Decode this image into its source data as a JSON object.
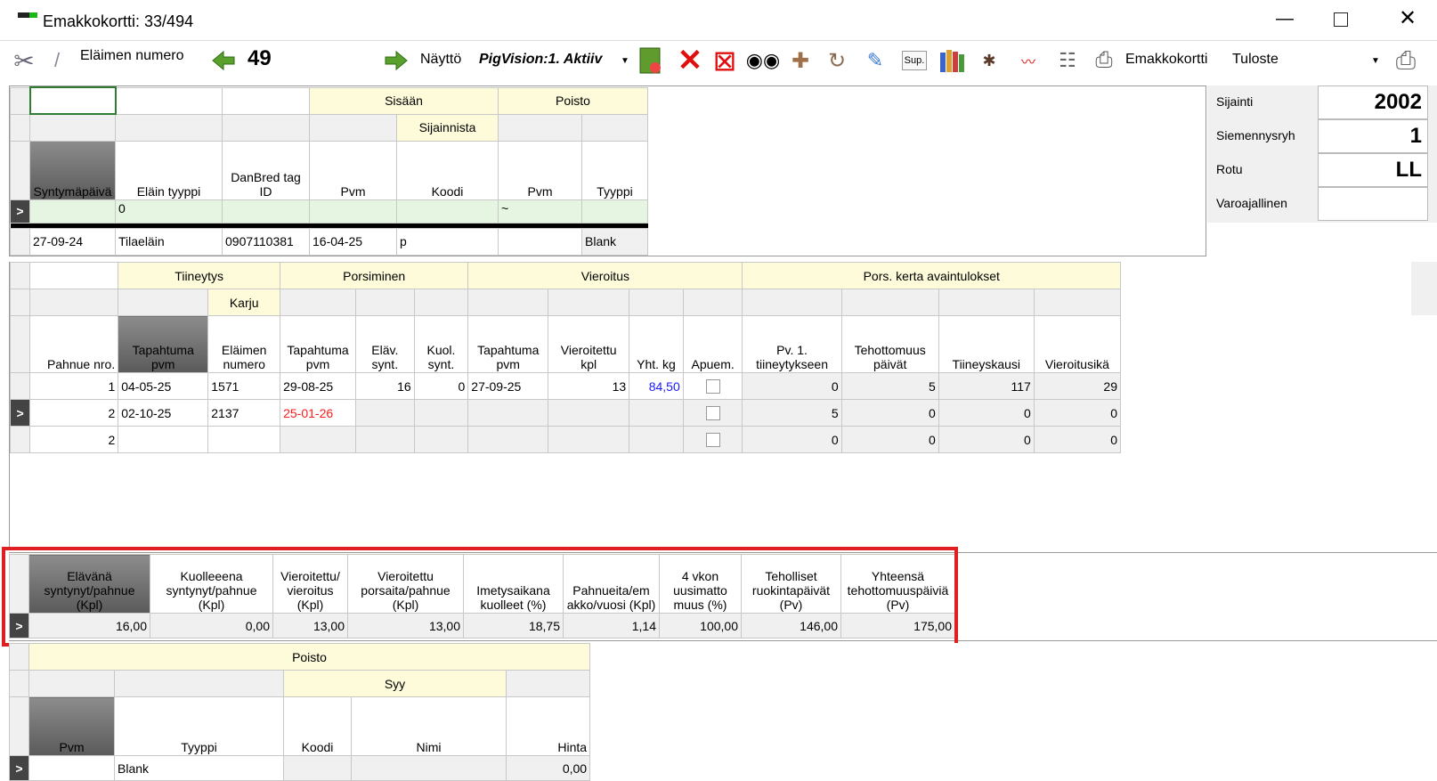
{
  "window": {
    "title": "Emakkokortti: 33/494"
  },
  "toolbar": {
    "animal_number_label": "Eläimen numero",
    "animal_number": "49",
    "view_label": "Näyttö",
    "view_value": "PigVision:1. Aktiiv",
    "card_label": "Emakkokortti",
    "print_value": "Tuloste",
    "sup_label": "Sup."
  },
  "info_panel": {
    "location_label": "Sijainti",
    "location": "2002",
    "semen_group_label": "Siemennysryh",
    "semen_group": "1",
    "breed_label": "Rotu",
    "breed": "LL",
    "reserve_label": "Varoajallinen",
    "reserve": ""
  },
  "animal_grid": {
    "group_in": "Sisään",
    "group_out": "Poisto",
    "sub_from_location": "Sijainnista",
    "headers": {
      "birth_date": "Syntymäpäivä",
      "animal_type": "Eläin tyyppi",
      "tag": "DanBred tag ID",
      "in_date": "Pvm",
      "in_code": "Koodi",
      "out_date": "Pvm",
      "out_type": "Tyyppi"
    },
    "new_row": {
      "animal_type": "0",
      "out_date": "~"
    },
    "row": {
      "birth_date": "27-09-24",
      "animal_type": "Tilaeläin",
      "tag": "0907110381",
      "in_date": "16-04-25",
      "in_code": "p",
      "out_date": "",
      "out_type": "Blank"
    }
  },
  "litter_grid": {
    "groups": {
      "pregnancy": "Tiineytys",
      "boar": "Karju",
      "farrowing": "Porsiminen",
      "weaning": "Vieroitus",
      "kpi": "Pors. kerta avaintulokset"
    },
    "headers": {
      "litter": "Pahnue nro.",
      "preg_date": "Tapahtuma pvm",
      "boar_no": "Eläimen numero",
      "farrow_date": "Tapahtuma pvm",
      "live_born": "Eläv. synt.",
      "dead_born": "Kuol. synt.",
      "wean_date": "Tapahtuma pvm",
      "weaned": "Vieroitettu kpl",
      "total_kg": "Yht. kg",
      "nurse": "Apuem.",
      "days_to_preg": "Pv. 1. tiineytykseen",
      "nonprod_days": "Tehottomuus päivät",
      "preg_period": "Tiineyskausi",
      "wean_age": "Vieroitusikä"
    },
    "rows": [
      {
        "litter": "1",
        "preg_date": "04-05-25",
        "boar_no": "1571",
        "farrow_date": "29-08-25",
        "live_born": "16",
        "dead_born": "0",
        "wean_date": "27-09-25",
        "weaned": "13",
        "total_kg": "84,50",
        "days_to_preg": "0",
        "nonprod_days": "5",
        "preg_period": "117",
        "wean_age": "29"
      },
      {
        "litter": "2",
        "preg_date": "02-10-25",
        "boar_no": "2137",
        "farrow_date": "25-01-26",
        "live_born": "",
        "dead_born": "",
        "wean_date": "",
        "weaned": "",
        "total_kg": "",
        "days_to_preg": "5",
        "nonprod_days": "0",
        "preg_period": "0",
        "wean_age": "0"
      },
      {
        "litter": "2",
        "preg_date": "",
        "boar_no": "",
        "farrow_date": "",
        "live_born": "",
        "dead_born": "",
        "wean_date": "",
        "weaned": "",
        "total_kg": "",
        "days_to_preg": "0",
        "nonprod_days": "0",
        "preg_period": "0",
        "wean_age": "0"
      }
    ]
  },
  "summary_grid": {
    "headers": [
      "Elävänä syntynyt/pahnue (Kpl)",
      "Kuolleeena syntynyt/pahnue (Kpl)",
      "Vieroitettu/ vieroitus (Kpl)",
      "Vieroitettu porsaita/pahnue (Kpl)",
      "Imetysaikana kuolleet (%)",
      "Pahnueita/em akko/vuosi (Kpl)",
      "4 vkon uusimatto muus (%)",
      "Teholliset ruokintapäivät (Pv)",
      "Yhteensä tehottomuuspäiviä (Pv)"
    ],
    "values": [
      "16,00",
      "0,00",
      "13,00",
      "13,00",
      "18,75",
      "1,14",
      "100,00",
      "146,00",
      "175,00"
    ]
  },
  "removal_grid": {
    "group": "Poisto",
    "sub_reason": "Syy",
    "headers": {
      "date": "Pvm",
      "type": "Tyyppi",
      "code": "Koodi",
      "name": "Nimi",
      "price": "Hinta"
    },
    "row": {
      "date": "",
      "type": "Blank",
      "code": "",
      "name": "",
      "price": "0,00"
    }
  },
  "colors": {
    "highlight": "#e02020",
    "link_blue": "#1a1aff",
    "alert_red": "#ff1a1a",
    "new_row": "#e6f5e1",
    "group_header": "#fdfbd9"
  }
}
